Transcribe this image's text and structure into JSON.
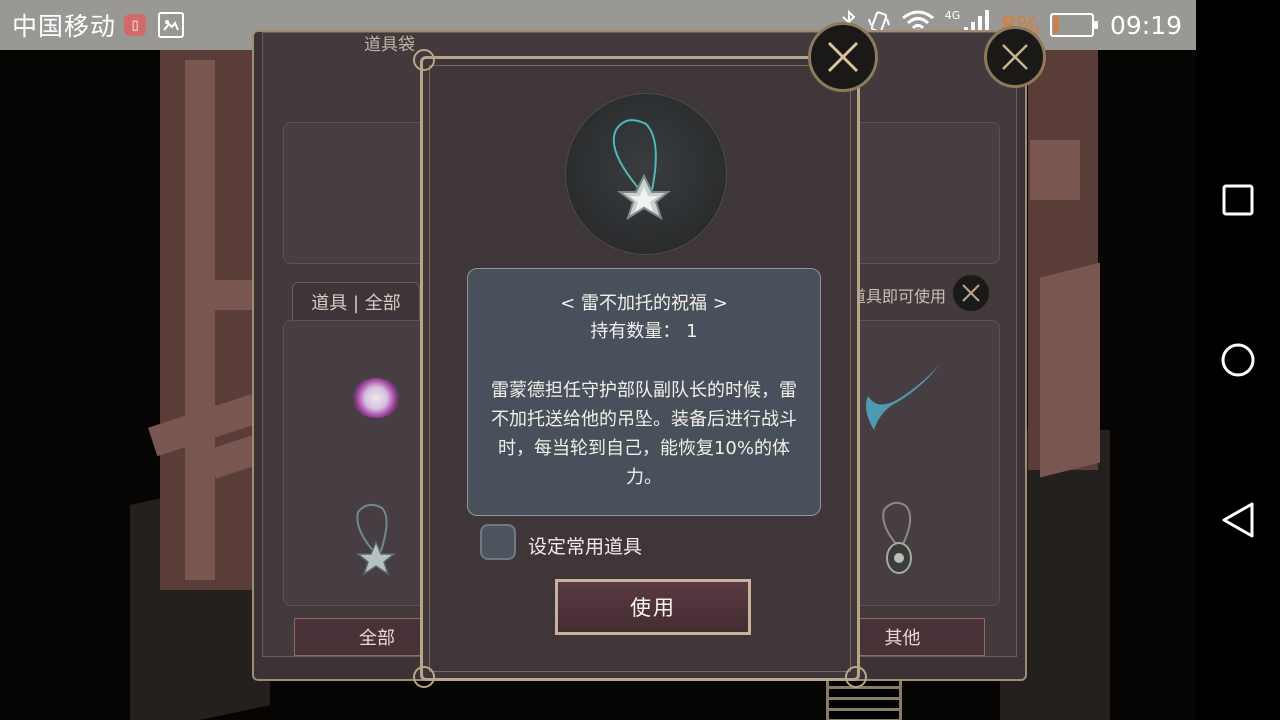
{
  "status_bar": {
    "carrier": "中国移动",
    "network": "4G",
    "battery_percent": "8%",
    "battery_level": 0.08,
    "time": "09:19"
  },
  "inventory_panel": {
    "title": "道具袋",
    "tab_label": "道具 | 全部",
    "hint": "点击道具即可使用",
    "categories": [
      "全部",
      "其他"
    ]
  },
  "item_detail": {
    "name": "< 雷不加托的祝福 >",
    "count_label": "持有数量：",
    "count_value": "1",
    "description": "雷蒙德担任守护部队副队长的时候，雷不加托送给他的吊坠。装备后进行战斗时，每当轮到自己，能恢复10%的体力。",
    "favorite_label": "设定常用道具",
    "favorite_checked": false,
    "use_button": "使用"
  },
  "colors": {
    "status_bar": "#9a9895",
    "battery_low": "#e07a30",
    "dialog_bg": "#3e3639",
    "desc_bg": "#48505b",
    "button_bg": "#4a2f37",
    "frame_gold": "#b8a68b"
  },
  "icons": [
    "notification-icon",
    "gallery-icon",
    "bluetooth-icon",
    "vibrate-icon",
    "wifi-icon",
    "signal-icon",
    "battery-icon",
    "recent-apps-icon",
    "home-icon",
    "back-icon",
    "close-icon",
    "pendant-icon"
  ]
}
